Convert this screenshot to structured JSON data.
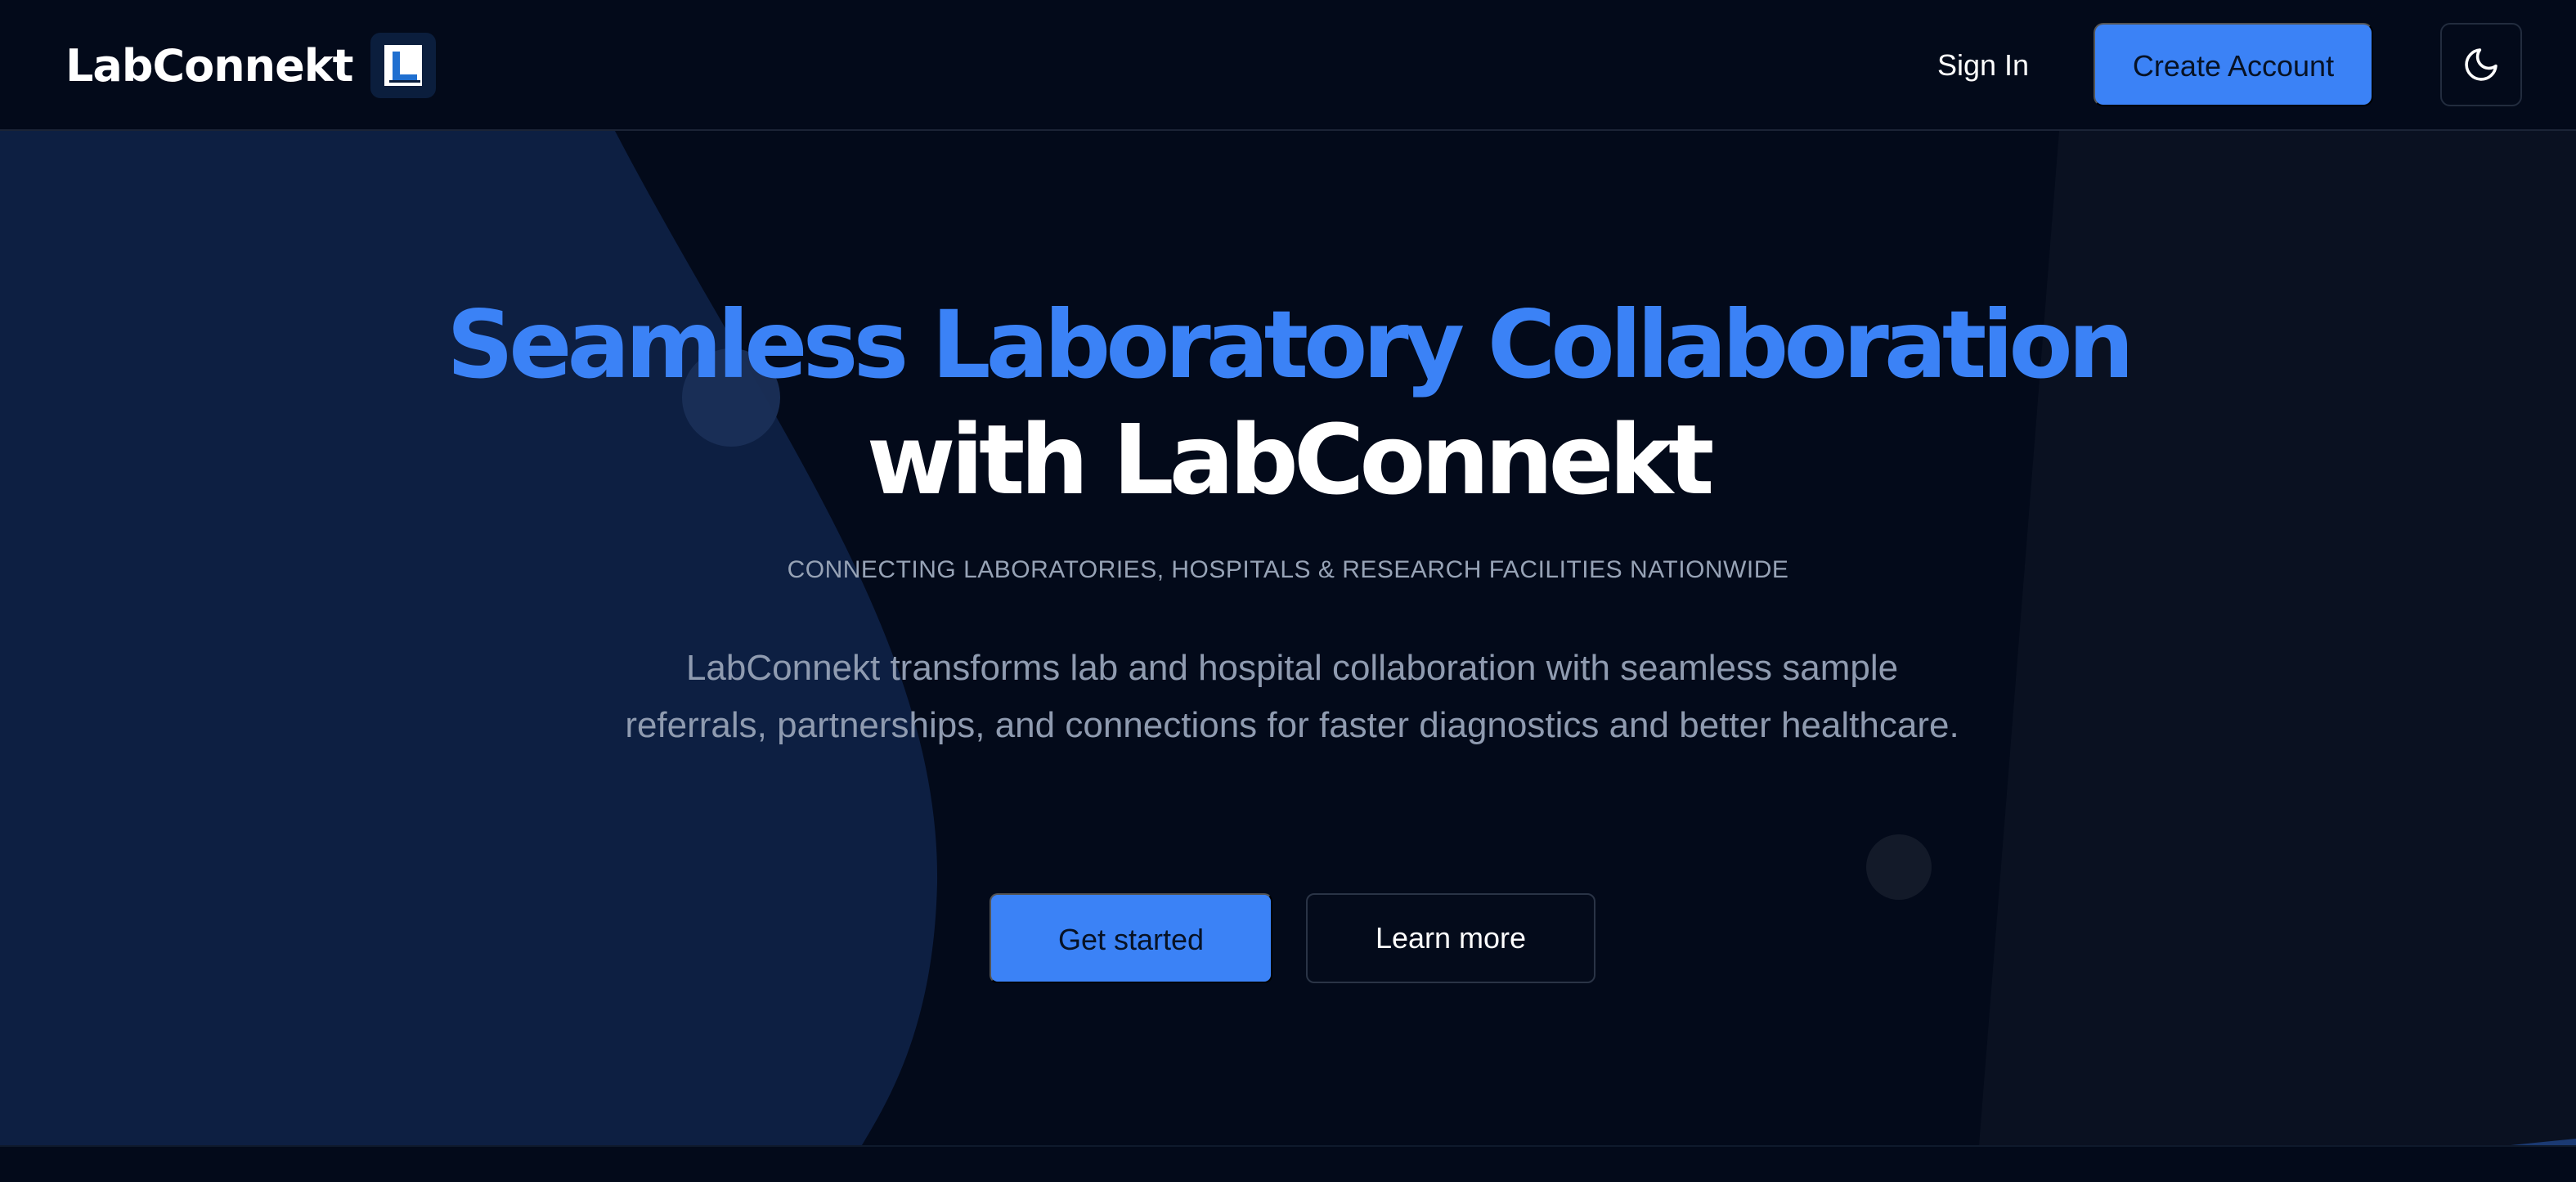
{
  "header": {
    "brand_name": "LabConnekt",
    "logo_icon": "labconnekt-logo-icon",
    "sign_in_label": "Sign In",
    "create_account_label": "Create Account",
    "theme_toggle_icon": "moon-icon"
  },
  "hero": {
    "headline_line1": "Seamless Laboratory Collaboration",
    "headline_line2": "with LabConnekt",
    "tagline": "CONNECTING LABORATORIES, HOSPITALS & RESEARCH FACILITIES NATIONWIDE",
    "description": "LabConnekt transforms lab and hospital collaboration with seamless sample referrals, partnerships, and connections for faster diagnostics and better healthcare.",
    "primary_button_label": "Get started",
    "secondary_button_label": "Learn more"
  },
  "colors": {
    "background": "#030a1a",
    "accent": "#3b82f6",
    "heading_white": "#ffffff",
    "muted_text": "#8f9bb0",
    "left_shape": "#0d1f42",
    "right_panel": "#0a1121"
  }
}
